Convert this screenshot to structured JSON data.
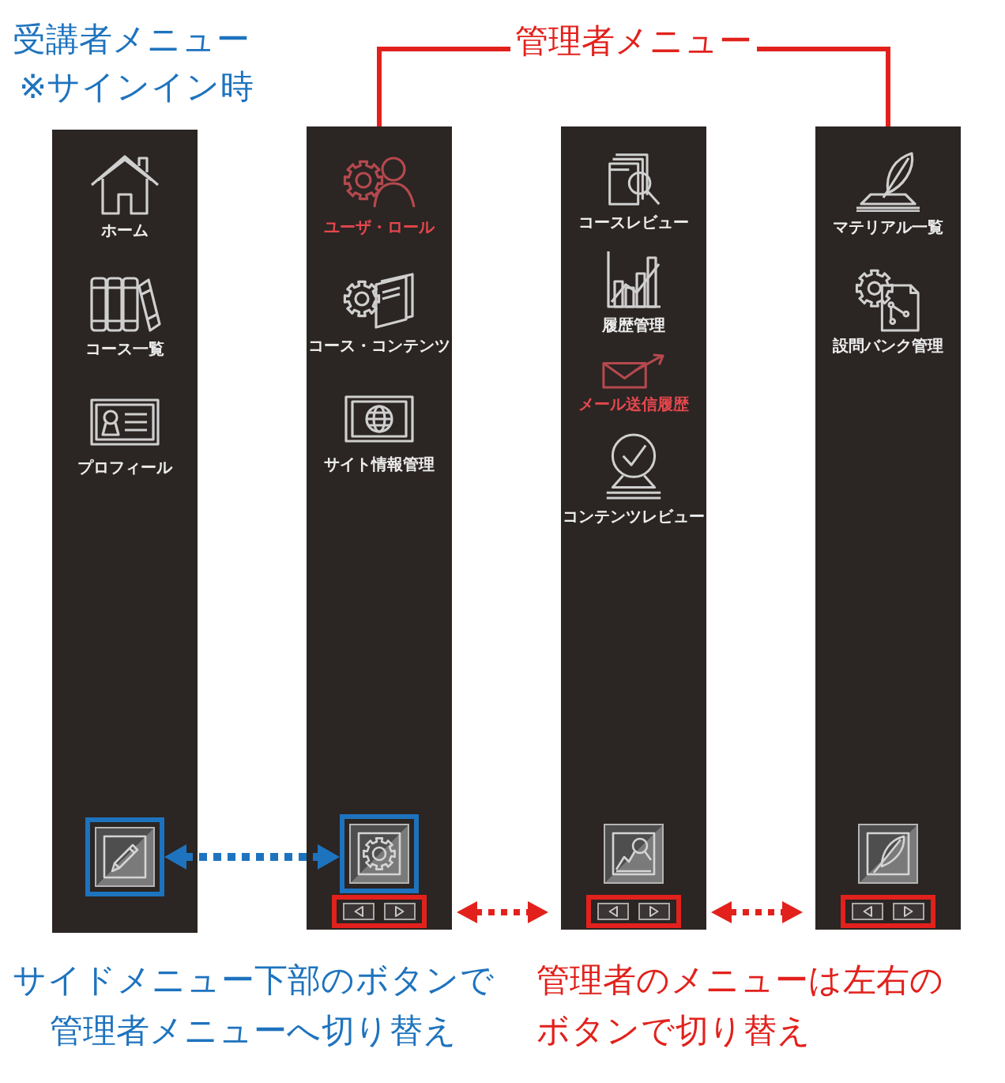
{
  "student_menu": {
    "title": "受講者メニュー",
    "note": "※サインイン時",
    "panel": {
      "items": [
        {
          "label": "ホーム",
          "selected": false
        },
        {
          "label": "コース一覧",
          "selected": false
        },
        {
          "label": "プロフィール",
          "selected": false
        }
      ],
      "switch_button": {
        "highlighted": true
      }
    }
  },
  "admin_menu": {
    "title": "管理者メニュー",
    "panels": [
      {
        "items": [
          {
            "label": "ユーザ・ロール",
            "selected": true
          },
          {
            "label": "コース・コンテンツ",
            "selected": false
          },
          {
            "label": "サイト情報管理",
            "selected": false
          }
        ],
        "switch_button": {
          "highlighted": true
        },
        "pager": {
          "highlighted": true
        }
      },
      {
        "items": [
          {
            "label": "コースレビュー",
            "selected": false
          },
          {
            "label": "履歴管理",
            "selected": false
          },
          {
            "label": "メール送信履歴",
            "selected": true
          },
          {
            "label": "コンテンツレビュー",
            "selected": false
          }
        ],
        "switch_button": {
          "highlighted": false
        },
        "pager": {
          "highlighted": true
        }
      },
      {
        "items": [
          {
            "label": "マテリアル一覧",
            "selected": false
          },
          {
            "label": "設問バンク管理",
            "selected": false
          }
        ],
        "switch_button": {
          "highlighted": false
        },
        "pager": {
          "highlighted": true
        }
      }
    ]
  },
  "captions": [
    {
      "text": "サイドメニュー下部のボタンで管理者メニューへ切り替え",
      "color": "#1e73be"
    },
    {
      "text": "管理者のメニューは左右のボタンで切り替え",
      "color": "#e2211c"
    }
  ]
}
